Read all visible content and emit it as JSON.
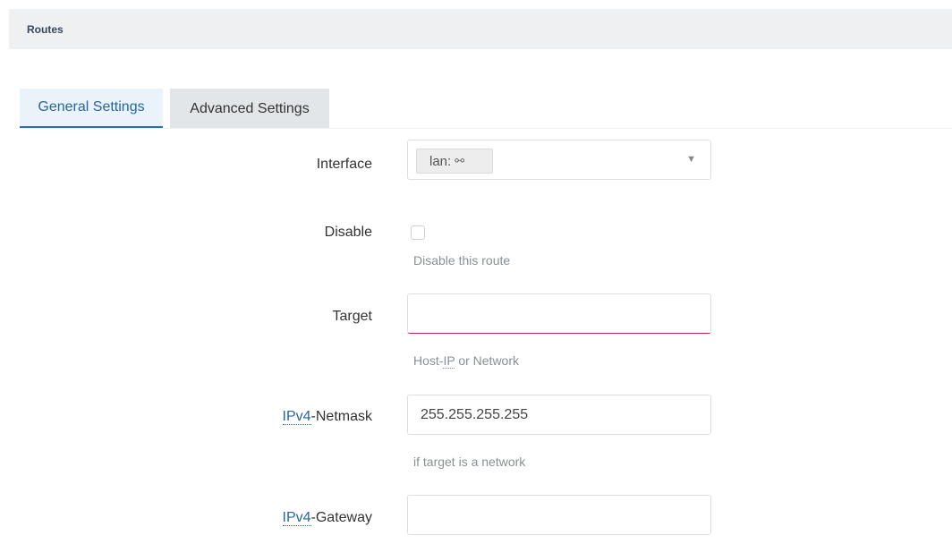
{
  "section": {
    "title": "Routes"
  },
  "tabs": [
    {
      "label": "General Settings",
      "active": true
    },
    {
      "label": "Advanced Settings",
      "active": false
    }
  ],
  "form": {
    "interface": {
      "label": "Interface",
      "value": "lan:",
      "icon": "network-interface-icon"
    },
    "disable": {
      "label": "Disable",
      "checked": false,
      "hint": "Disable this route"
    },
    "target": {
      "label": "Target",
      "value": "",
      "hint_prefix": "Host-",
      "hint_abbr": "IP",
      "hint_suffix": " or Network"
    },
    "netmask": {
      "label_abbr": "IPv4",
      "label_suffix": "-Netmask",
      "value": "255.255.255.255",
      "hint": "if target is a network"
    },
    "gateway": {
      "label_abbr": "IPv4",
      "label_suffix": "-Gateway",
      "value": ""
    }
  },
  "colors": {
    "accent": "#2566a8",
    "invalid": "#c7254e",
    "header_bg": "#eef0f2"
  }
}
